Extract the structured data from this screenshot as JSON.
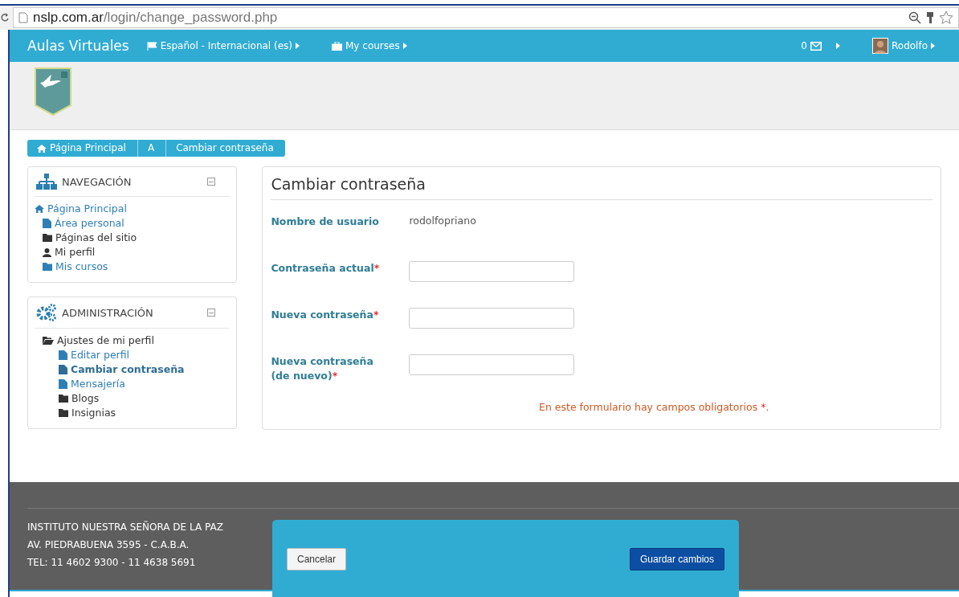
{
  "browser": {
    "url_host": "nslp.com.ar",
    "url_path": "/login/change_password.php"
  },
  "navbar": {
    "brand": "Aulas Virtuales",
    "menus": [
      {
        "label": "Español - Internacional (es)",
        "kind": "flag"
      },
      {
        "label": "My courses",
        "kind": "briefcase"
      }
    ],
    "messages": "0",
    "user": "Rodolfo"
  },
  "breadcrumb": [
    "Página Principal",
    "A",
    "Cambiar contraseña"
  ],
  "navigation_block": {
    "title": "NAVEGACIÓN",
    "items": [
      {
        "label": "Página Principal",
        "kind": "home",
        "link": true,
        "children": [
          {
            "label": "Área personal",
            "kind": "page",
            "link": true
          },
          {
            "label": "Páginas del sitio",
            "kind": "folder",
            "link": false
          },
          {
            "label": "Mi perfil",
            "kind": "user",
            "link": false
          },
          {
            "label": "Mis cursos",
            "kind": "folder",
            "link": true
          }
        ]
      }
    ]
  },
  "administration_block": {
    "title": "ADMINISTRACIÓN",
    "items": [
      {
        "label": "Ajustes de mi perfil",
        "kind": "open-folder",
        "link": false,
        "selected": false,
        "children": [
          {
            "label": "Editar perfil",
            "kind": "page",
            "link": true,
            "selected": false
          },
          {
            "label": "Cambiar contraseña",
            "kind": "page",
            "link": true,
            "selected": true
          },
          {
            "label": "Mensajería",
            "kind": "page",
            "link": true,
            "selected": false
          },
          {
            "label": "Blogs",
            "kind": "folder",
            "link": false,
            "selected": false
          },
          {
            "label": "Insignias",
            "kind": "folder",
            "link": false,
            "selected": false
          }
        ]
      }
    ]
  },
  "form": {
    "title": "Cambiar contraseña",
    "fields": [
      {
        "label": "Nombre de usuario",
        "kind": "static",
        "value": "rodolfopriano",
        "required": false
      },
      {
        "label": "Contraseña actual",
        "kind": "input",
        "required": true
      },
      {
        "label": "Nueva contraseña",
        "kind": "input",
        "required": true
      },
      {
        "label": "Nueva contraseña (de nuevo)",
        "kind": "input",
        "required": true
      }
    ],
    "required_note": "En este formulario hay campos obligatorios",
    "required_mark": "*",
    "required_note_end": "."
  },
  "footer": [
    "INSTITUTO NUESTRA SEÑORA DE LA PAZ",
    "AV. PIEDRABUENA 3595 - C.A.B.A.",
    "TEL: 11 4602 9300 - 11 4638 5691"
  ],
  "dialog": {
    "buttons": [
      "Cancelar",
      "Guardar cambios"
    ]
  }
}
